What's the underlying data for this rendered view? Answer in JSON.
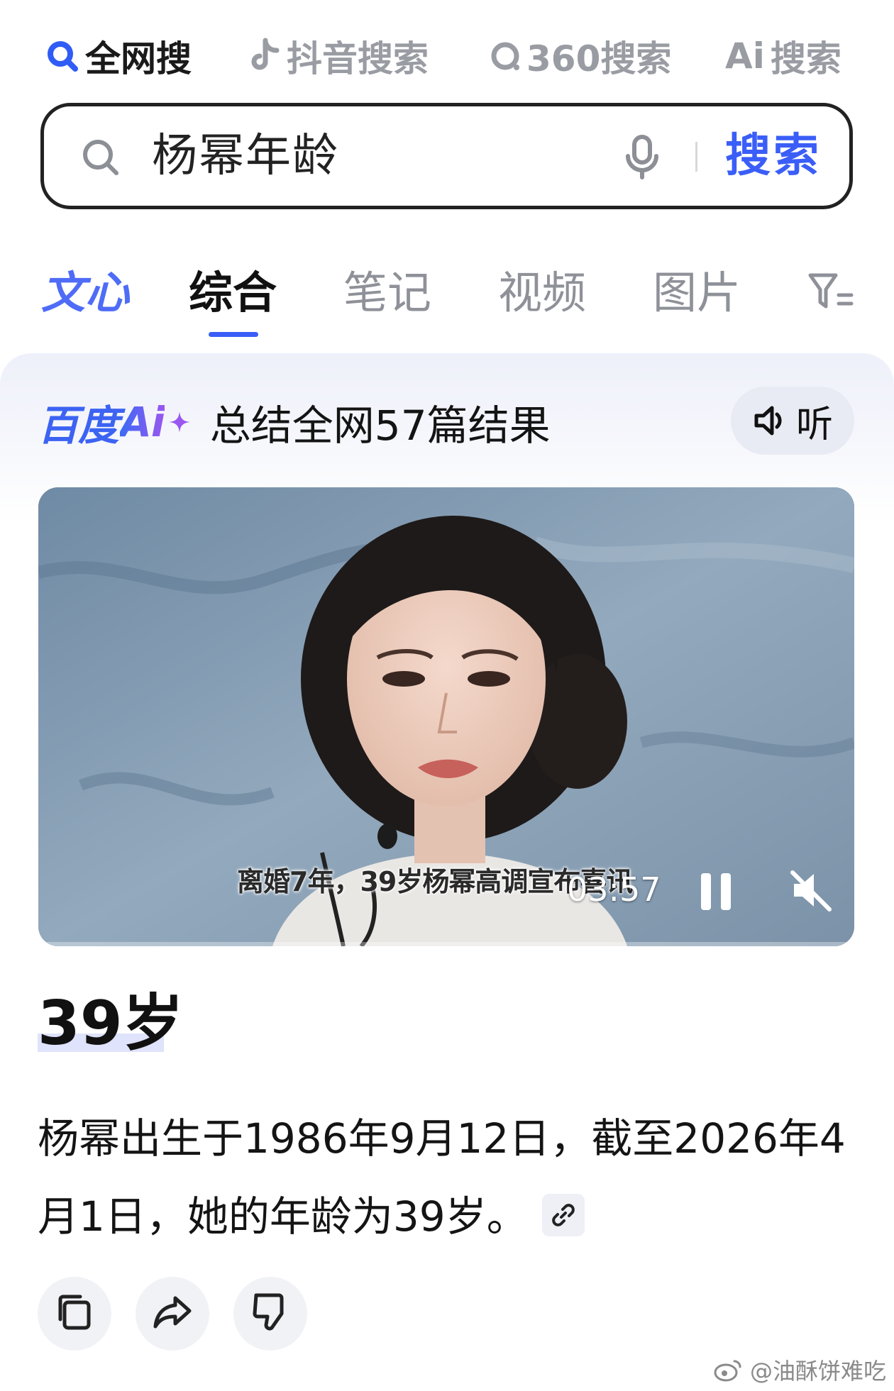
{
  "engines": [
    {
      "label": "全网搜",
      "icon": "magnifier-icon",
      "active": true
    },
    {
      "label": "抖音搜索",
      "icon": "tiktok-icon",
      "active": false
    },
    {
      "label": "360搜索",
      "icon": "360-logo-icon",
      "active": false
    },
    {
      "label": "搜索",
      "prefix": "Ai",
      "icon": "ai-logo-icon",
      "active": false
    }
  ],
  "search": {
    "query": "杨幂年龄",
    "button_label": "搜索"
  },
  "tabs": [
    {
      "label": "文心",
      "style": "brand"
    },
    {
      "label": "综合",
      "active": true
    },
    {
      "label": "笔记"
    },
    {
      "label": "视频"
    },
    {
      "label": "图片"
    }
  ],
  "ai_card": {
    "logo_text": "百度",
    "logo_ai": "Ai",
    "summary": "总结全网57篇结果",
    "listen_label": "听"
  },
  "video": {
    "subtitle": "离婚7年，39岁杨幂高调宣布喜讯",
    "timecode": "03:57",
    "muted": true,
    "playing": true
  },
  "answer": {
    "headline": "39岁",
    "description": "杨幂出生于1986年9月12日，截至2026年4月1日，她的年龄为39岁。"
  },
  "watermark": "@油酥饼难吃",
  "colors": {
    "accent": "#3a5ef7",
    "brand_purple": "#9a57f0",
    "muted_text": "#8f9199"
  }
}
